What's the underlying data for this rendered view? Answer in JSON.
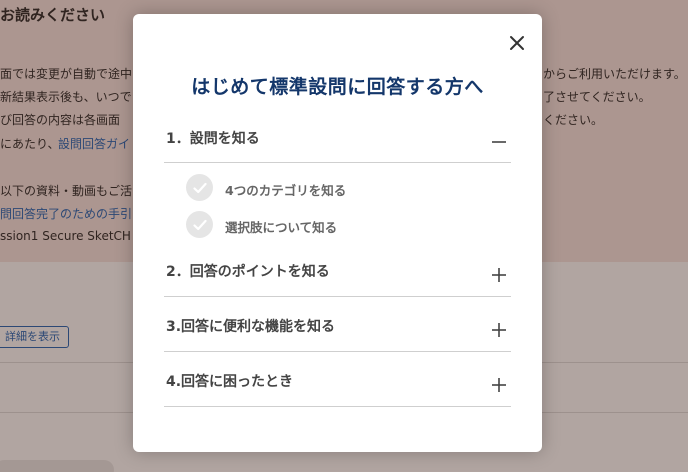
{
  "background": {
    "notice_title": "お読みください",
    "lines": [
      "面では変更が自動で途中",
      "新結果表示後も、いつで",
      "び回答の内容は各画面",
      "にあたり、",
      "以下の資料・動画もご活",
      "問回答完了のための手引",
      "ssion1 Secure SketCH"
    ],
    "guide_link": "設問回答ガイ",
    "right_lines": [
      "からご利用いただけます。",
      "了させてください。",
      "ください。"
    ],
    "details_button": "詳細を表示",
    "bottom_pill": "",
    "colors": {
      "notice_bg": "#f6e6e2",
      "link": "#1a5fb4"
    }
  },
  "modal": {
    "close_icon": "close-icon",
    "title": "はじめて標準設問に回答する方へ",
    "sections": [
      {
        "label": "1．設問を知る",
        "expanded": true,
        "toggle_icon": "minus-icon",
        "items": [
          {
            "label": "4つのカテゴリを知る",
            "icon": "check-icon"
          },
          {
            "label": "選択肢について知る",
            "icon": "check-icon"
          }
        ]
      },
      {
        "label": "2．回答のポイントを知る",
        "expanded": false,
        "toggle_icon": "plus-icon"
      },
      {
        "label": "3.回答に便利な機能を知る",
        "expanded": false,
        "toggle_icon": "plus-icon"
      },
      {
        "label": "4.回答に困ったとき",
        "expanded": false,
        "toggle_icon": "plus-icon"
      }
    ],
    "colors": {
      "title": "#14376b",
      "divider": "#cfcfcf",
      "check_bg": "#e5e5e5"
    }
  }
}
